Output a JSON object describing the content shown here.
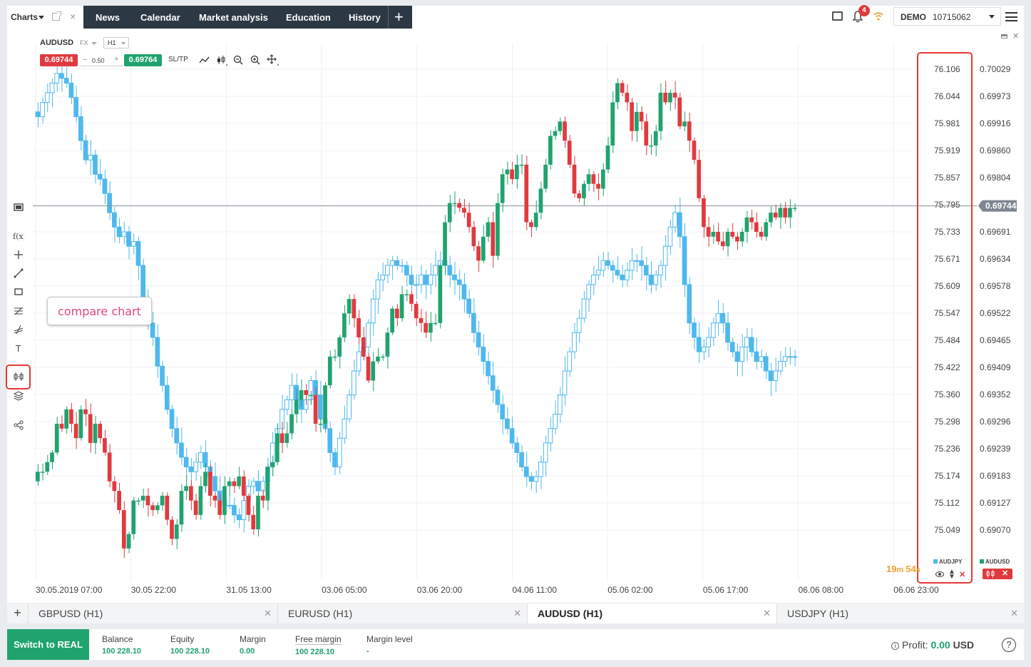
{
  "topbar": {
    "charts_label": "Charts",
    "nav": [
      "News",
      "Calendar",
      "Market analysis",
      "Education",
      "History"
    ],
    "notifications_count": "4",
    "account_type": "DEMO",
    "account_number": "10715062"
  },
  "chart": {
    "symbol": "AUDUSD",
    "symbol_type": "FX",
    "timeframe": "H1",
    "sell_price": "0.69744",
    "quantity": "0.50",
    "buy_price": "0.69764",
    "sltp_label": "SL/TP",
    "current_price_label": "0.69744",
    "callout_text": "compare chart",
    "timer_minutes": "19",
    "timer_seconds": "54",
    "legend_compare": "AUDJPY",
    "legend_main": "AUDUSD",
    "colors": {
      "up": "#1fa36f",
      "down": "#e03a3e",
      "compare": "#4fb8ee"
    }
  },
  "chart_data": {
    "type": "candlestick",
    "series": [
      {
        "name": "AUDUSD",
        "axis": "right",
        "ylim": [
          0.6901,
          0.7006
        ]
      },
      {
        "name": "AUDJPY",
        "axis": "left-compare",
        "ylim": [
          75.02,
          76.13
        ]
      }
    ],
    "y_ticks_compare": [
      "76.106",
      "76.044",
      "75.981",
      "75.919",
      "75.857",
      "75.795",
      "75.733",
      "75.671",
      "75.609",
      "75.547",
      "75.484",
      "75.422",
      "75.360",
      "75.298",
      "75.236",
      "75.174",
      "75.112",
      "75.049"
    ],
    "y_ticks_main": [
      "0.70029",
      "0.69973",
      "0.69916",
      "0.69860",
      "0.69804",
      "0.69747",
      "0.69691",
      "0.69634",
      "0.69578",
      "0.69522",
      "0.69465",
      "0.69409",
      "0.69352",
      "0.69296",
      "0.69239",
      "0.69183",
      "0.69127",
      "0.69070"
    ],
    "x_ticks": [
      "30.05.2019 07:00",
      "30.05 22:00",
      "31.05 13:00",
      "03.06 05:00",
      "03.06 20:00",
      "04.06 11:00",
      "05.06 02:00",
      "05.06 17:00",
      "06.06 08:00",
      "06.06 23:00"
    ],
    "current_price": 0.69744,
    "audusd_close": [
      0.6919,
      0.6919,
      0.6921,
      0.6923,
      0.6929,
      0.6928,
      0.6932,
      0.6929,
      0.6926,
      0.6932,
      0.6931,
      0.6925,
      0.6929,
      0.6926,
      0.6923,
      0.6917,
      0.6915,
      0.6911,
      0.6903,
      0.6906,
      0.6913,
      0.6913,
      0.6914,
      0.6912,
      0.6911,
      0.6912,
      0.6914,
      0.6909,
      0.6905,
      0.6908,
      0.6915,
      0.6916,
      0.6913,
      0.691,
      0.6916,
      0.6919,
      0.6914,
      0.6913,
      0.691,
      0.6916,
      0.6917,
      0.6916,
      0.6918,
      0.6914,
      0.691,
      0.6907,
      0.6914,
      0.6913,
      0.692,
      0.6921,
      0.6927,
      0.6925,
      0.6927,
      0.6931,
      0.6934,
      0.6936,
      0.6935,
      0.6935,
      0.6929,
      0.6929,
      0.6937,
      0.6943,
      0.6943,
      0.6947,
      0.6952,
      0.6955,
      0.6951,
      0.6947,
      0.6943,
      0.6938,
      0.6942,
      0.6943,
      0.6943,
      0.6948,
      0.6953,
      0.6951,
      0.6956,
      0.6956,
      0.6954,
      0.6951,
      0.695,
      0.6948,
      0.695,
      0.695,
      0.6962,
      0.6971,
      0.6975,
      0.6975,
      0.6974,
      0.6973,
      0.697,
      0.6966,
      0.6963,
      0.6968,
      0.6971,
      0.6964,
      0.6975,
      0.6981,
      0.6982,
      0.698,
      0.6983,
      0.6983,
      0.6971,
      0.697,
      0.6973,
      0.6978,
      0.6983,
      0.6989,
      0.699,
      0.6992,
      0.6988,
      0.6983,
      0.6977,
      0.6976,
      0.6979,
      0.6981,
      0.6979,
      0.6978,
      0.6982,
      0.6987,
      0.6996,
      0.7,
      0.6998,
      0.6996,
      0.699,
      0.6994,
      0.6992,
      0.6987,
      0.6987,
      0.699,
      0.6998,
      0.6996,
      0.6998,
      0.6997,
      0.6991,
      0.6992,
      0.6988,
      0.6984,
      0.6976,
      0.697,
      0.6968,
      0.6969,
      0.6967,
      0.6966,
      0.6969,
      0.6968,
      0.6967,
      0.6969,
      0.6972,
      0.6971,
      0.6969,
      0.6968,
      0.6971,
      0.6973,
      0.6972,
      0.6974,
      0.6972,
      0.6974,
      0.6974
    ]
  },
  "chart_tabs": [
    {
      "label": "GBPUSD (H1)",
      "active": false
    },
    {
      "label": "EURUSD (H1)",
      "active": false
    },
    {
      "label": "AUDUSD (H1)",
      "active": true
    },
    {
      "label": "USDJPY (H1)",
      "active": false
    }
  ],
  "footer": {
    "switch_label": "Switch to REAL",
    "balance_label": "Balance",
    "balance": "100 228.10",
    "equity_label": "Equity",
    "equity": "100 228.10",
    "margin_label": "Margin",
    "margin": "0.00",
    "free_margin_label": "Free margin",
    "free_margin": "100 228.10",
    "margin_level_label": "Margin level",
    "margin_level": "-",
    "profit_label": "Profit:",
    "profit_value": "0.00",
    "profit_currency": "USD",
    "help": "?"
  }
}
